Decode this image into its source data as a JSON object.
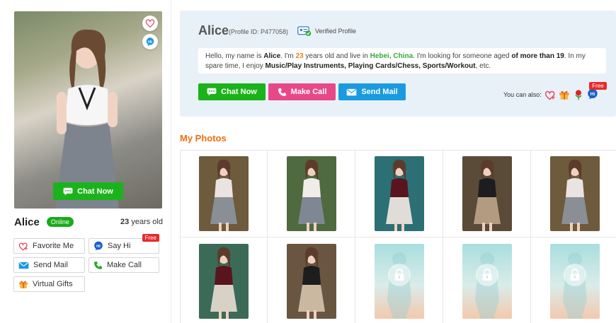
{
  "sidebar": {
    "photo_chat_label": "Chat Now",
    "name": "Alice",
    "online_label": "Online",
    "age_number": "23",
    "age_suffix": " years old",
    "actions": {
      "favorite": "Favorite Me",
      "say_hi": "Say Hi",
      "say_hi_free": "Free",
      "send_mail": "Send Mail",
      "make_call": "Make Call",
      "virtual_gifts": "Virtual Gifts"
    }
  },
  "profile": {
    "name": "Alice",
    "profile_id": "(Profile ID: P477058)",
    "verified_label": "Verified Profile",
    "bio": {
      "p1": "Hello, my name is ",
      "name": "Alice",
      "p2": ". I'm ",
      "age": "23",
      "p3": " years old and live in ",
      "location": "Hebei, China",
      "p4": ". I'm looking for someone aged ",
      "seek": "of more than 19",
      "p5": ". In my spare time, I enjoy ",
      "hobbies": "Music/Play Instruments, Playing Cards/Chess, Sports/Workout",
      "p6": ", etc."
    },
    "buttons": {
      "chat": "Chat Now",
      "call": "Make Call",
      "mail": "Send Mail"
    },
    "also_label": "You can also:",
    "also_free": "Free"
  },
  "photos": {
    "title": "My Photos",
    "items": [
      {
        "kind": "photo",
        "palette": [
          "#6e5a3c",
          "#e9e4e1",
          "#8a8f96"
        ]
      },
      {
        "kind": "photo",
        "palette": [
          "#4f6a3e",
          "#f0ece8",
          "#7f8794"
        ]
      },
      {
        "kind": "photo",
        "palette": [
          "#2c6f74",
          "#5a1420",
          "#e0ddd8"
        ]
      },
      {
        "kind": "photo",
        "palette": [
          "#5a4a38",
          "#1d1d1f",
          "#b39b7f"
        ]
      },
      {
        "kind": "photo",
        "palette": [
          "#6e5a3c",
          "#e9e4e1",
          "#8a8f96"
        ]
      },
      {
        "kind": "photo",
        "palette": [
          "#3b6b57",
          "#5a1420",
          "#d8d2c6"
        ]
      },
      {
        "kind": "photo",
        "palette": [
          "#6a5640",
          "#1d1d1f",
          "#c8b9a0"
        ]
      },
      {
        "kind": "locked"
      },
      {
        "kind": "locked"
      },
      {
        "kind": "locked"
      }
    ]
  },
  "colors": {
    "green": "#1bb31b",
    "pink": "#e8488a",
    "blue": "#1a9be0",
    "orange": "#f06d13"
  }
}
